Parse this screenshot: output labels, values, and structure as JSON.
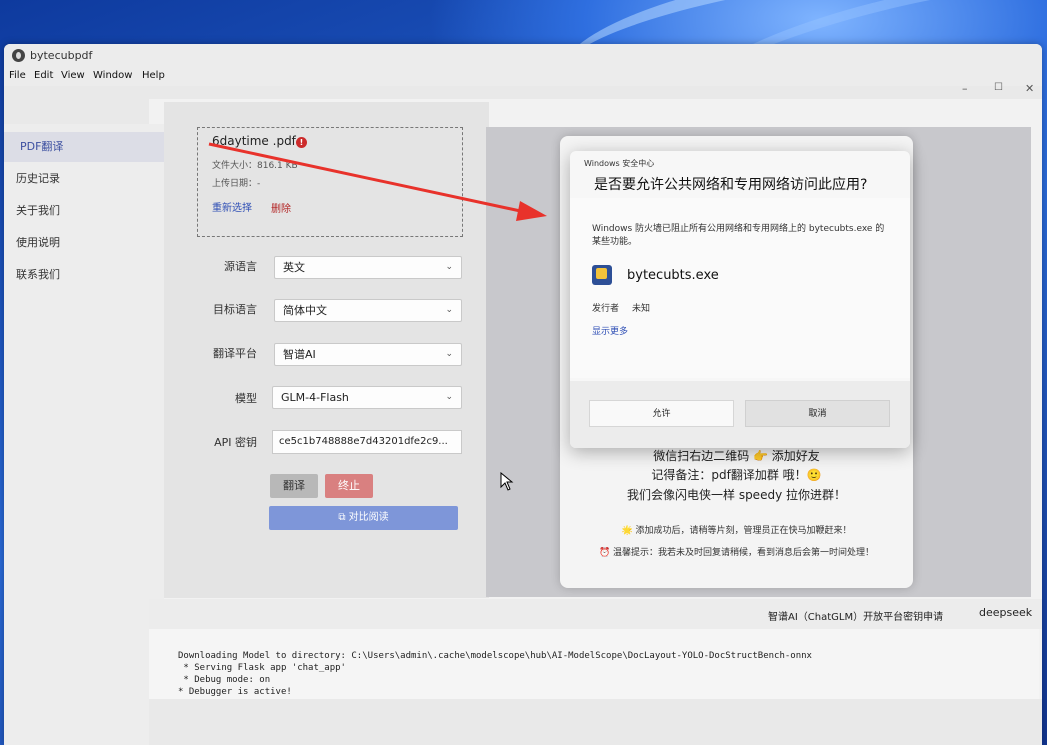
{
  "app": {
    "title": "bytecubpdf",
    "menu": [
      "File",
      "Edit",
      "View",
      "Window",
      "Help"
    ],
    "window_controls": [
      "–",
      "☐",
      "✕"
    ]
  },
  "sidebar": {
    "items": [
      {
        "label": "PDF翻译",
        "active": true
      },
      {
        "label": "历史记录",
        "active": false
      },
      {
        "label": "关于我们",
        "active": false
      },
      {
        "label": "使用说明",
        "active": false
      },
      {
        "label": "联系我们",
        "active": false
      }
    ]
  },
  "upload": {
    "file_name": "6daytime .pdf",
    "error_badge": "!",
    "file_size": "文件大小：816.1 KB",
    "upload_date": "上传日期：-",
    "reselect": "重新选择",
    "delete": "删除"
  },
  "form": {
    "source_language": {
      "label": "源语言",
      "value": "英文"
    },
    "target_language": {
      "label": "目标语言",
      "value": "简体中文"
    },
    "platform": {
      "label": "翻译平台",
      "value": "智谱AI"
    },
    "model": {
      "label": "模型",
      "value": "GLM-4-Flash"
    },
    "api_key": {
      "label": "API 密钥",
      "value": "ce5c1b748888e7d43201dfe2c9..."
    }
  },
  "actions": {
    "translate": "翻译",
    "stop": "终止",
    "compare": "对比阅读"
  },
  "promo": {
    "line1": "微信扫右边二维码 👉 添加好友",
    "line2": "记得备注：pdf翻译加群 哦！🙂",
    "line3": "我们会像闪电侠一样 speedy 拉你进群！",
    "note1": "🌟 添加成功后，请稍等片刻，管理员正在快马加鞭赶来！",
    "note2": "⏰ 温馨提示：我若未及时回复请稍候，看到消息后会第一时间处理！"
  },
  "links": {
    "zhipu": "智谱AI（ChatGLM）开放平台密钥申请",
    "deepseek": "deepseek"
  },
  "console": {
    "lines": [
      "Downloading Model to directory: C:\\Users\\admin\\.cache\\modelscope\\hub\\AI-ModelScope\\DocLayout-YOLO-DocStructBench-onnx",
      " * Serving Flask app 'chat_app'",
      " * Debug mode: on",
      "* Debugger is active!"
    ]
  },
  "dialog": {
    "source": "Windows 安全中心",
    "heading": "是否要允许公共网络和专用网络访问此应用?",
    "description": "Windows 防火墙已阻止所有公用网络和专用网络上的 bytecubts.exe 的某些功能。",
    "app_name": "bytecubts.exe",
    "publisher_label": "发行者",
    "publisher_value": "未知",
    "show_more": "显示更多",
    "allow": "允许",
    "cancel": "取消"
  },
  "colors": {
    "accent": "#3c4fa0",
    "stop": "#d98080",
    "compare": "#7e96d9",
    "arrow": "#e8322b"
  }
}
